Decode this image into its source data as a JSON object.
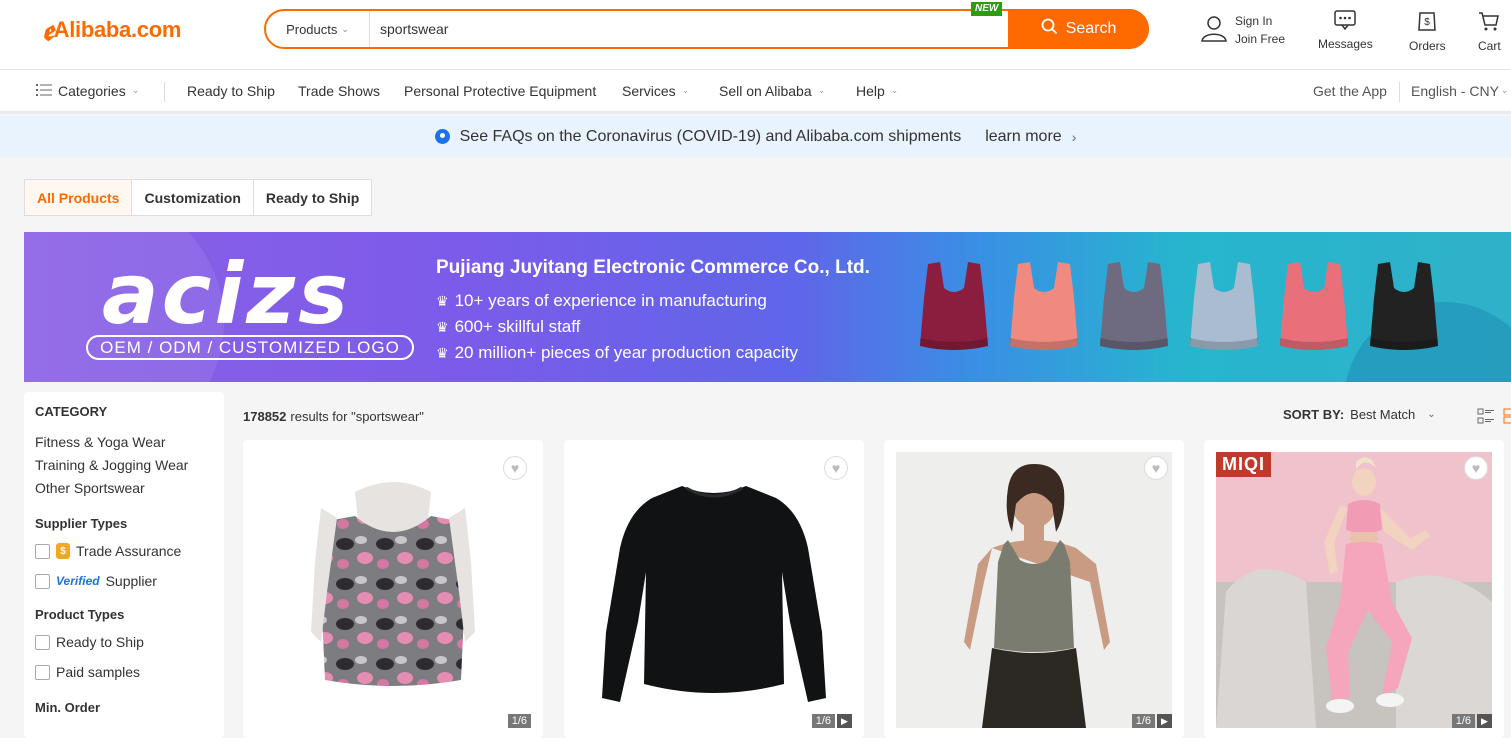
{
  "header": {
    "logo_text": "Alibaba.com",
    "search": {
      "category_label": "Products",
      "query": "sportswear",
      "new_badge": "NEW",
      "button_label": "Search"
    },
    "signin_line1": "Sign In",
    "signin_line2": "Join Free",
    "messages_label": "Messages",
    "orders_label": "Orders",
    "cart_label": "Cart",
    "accent_color": "#ff6a00"
  },
  "nav": {
    "categories_label": "Categories",
    "items": [
      {
        "label": "Ready to Ship",
        "dropdown": false
      },
      {
        "label": "Trade Shows",
        "dropdown": false
      },
      {
        "label": "Personal Protective Equipment",
        "dropdown": false
      },
      {
        "label": "Services",
        "dropdown": true
      },
      {
        "label": "Sell on Alibaba",
        "dropdown": true
      },
      {
        "label": "Help",
        "dropdown": true
      }
    ],
    "get_app_label": "Get the App",
    "language_label": "English - CNY"
  },
  "notice": {
    "text": "See FAQs on the Coronavirus (COVID-19) and Alibaba.com shipments",
    "link_label": "learn more"
  },
  "tabs": [
    {
      "label": "All Products",
      "active": true
    },
    {
      "label": "Customization",
      "active": false
    },
    {
      "label": "Ready to Ship",
      "active": false
    }
  ],
  "banner": {
    "brand": "acizs",
    "tagline": "OEM / ODM / CUSTOMIZED LOGO",
    "company": "Pujiang Juyitang Electronic Commerce Co., Ltd.",
    "bullets": [
      "10+  years of experience in manufacturing",
      "600+  skillful staff",
      "20 million+  pieces of year production capacity"
    ],
    "product_colors": [
      "#8b1e3f",
      "#f08a80",
      "#6e6a80",
      "#a9bcd0",
      "#e9707a",
      "#222222"
    ]
  },
  "sidebar": {
    "category_title": "CATEGORY",
    "categories": [
      "Fitness & Yoga Wear",
      "Training & Jogging Wear",
      "Other Sportswear"
    ],
    "supplier_types_title": "Supplier Types",
    "trade_assurance_label": "Trade Assurance",
    "verified_badge": "Verified",
    "supplier_label": "Supplier",
    "product_types_title": "Product Types",
    "product_types": [
      "Ready to Ship",
      "Paid samples"
    ],
    "min_order_title": "Min. Order"
  },
  "results": {
    "count": "178852",
    "suffix": "results for \"sportswear\"",
    "sort_label": "SORT BY:",
    "sort_value": "Best Match"
  },
  "products": [
    {
      "counter": "1/6",
      "video": false,
      "icon": "crop-top-image"
    },
    {
      "counter": "1/6",
      "video": true,
      "icon": "long-sleeve-shirt-image"
    },
    {
      "counter": "1/6",
      "video": true,
      "icon": "tank-top-model-image"
    },
    {
      "counter": "1/6",
      "video": true,
      "icon": "pink-leggings-model-image",
      "brand_tag": "MIQI"
    }
  ]
}
